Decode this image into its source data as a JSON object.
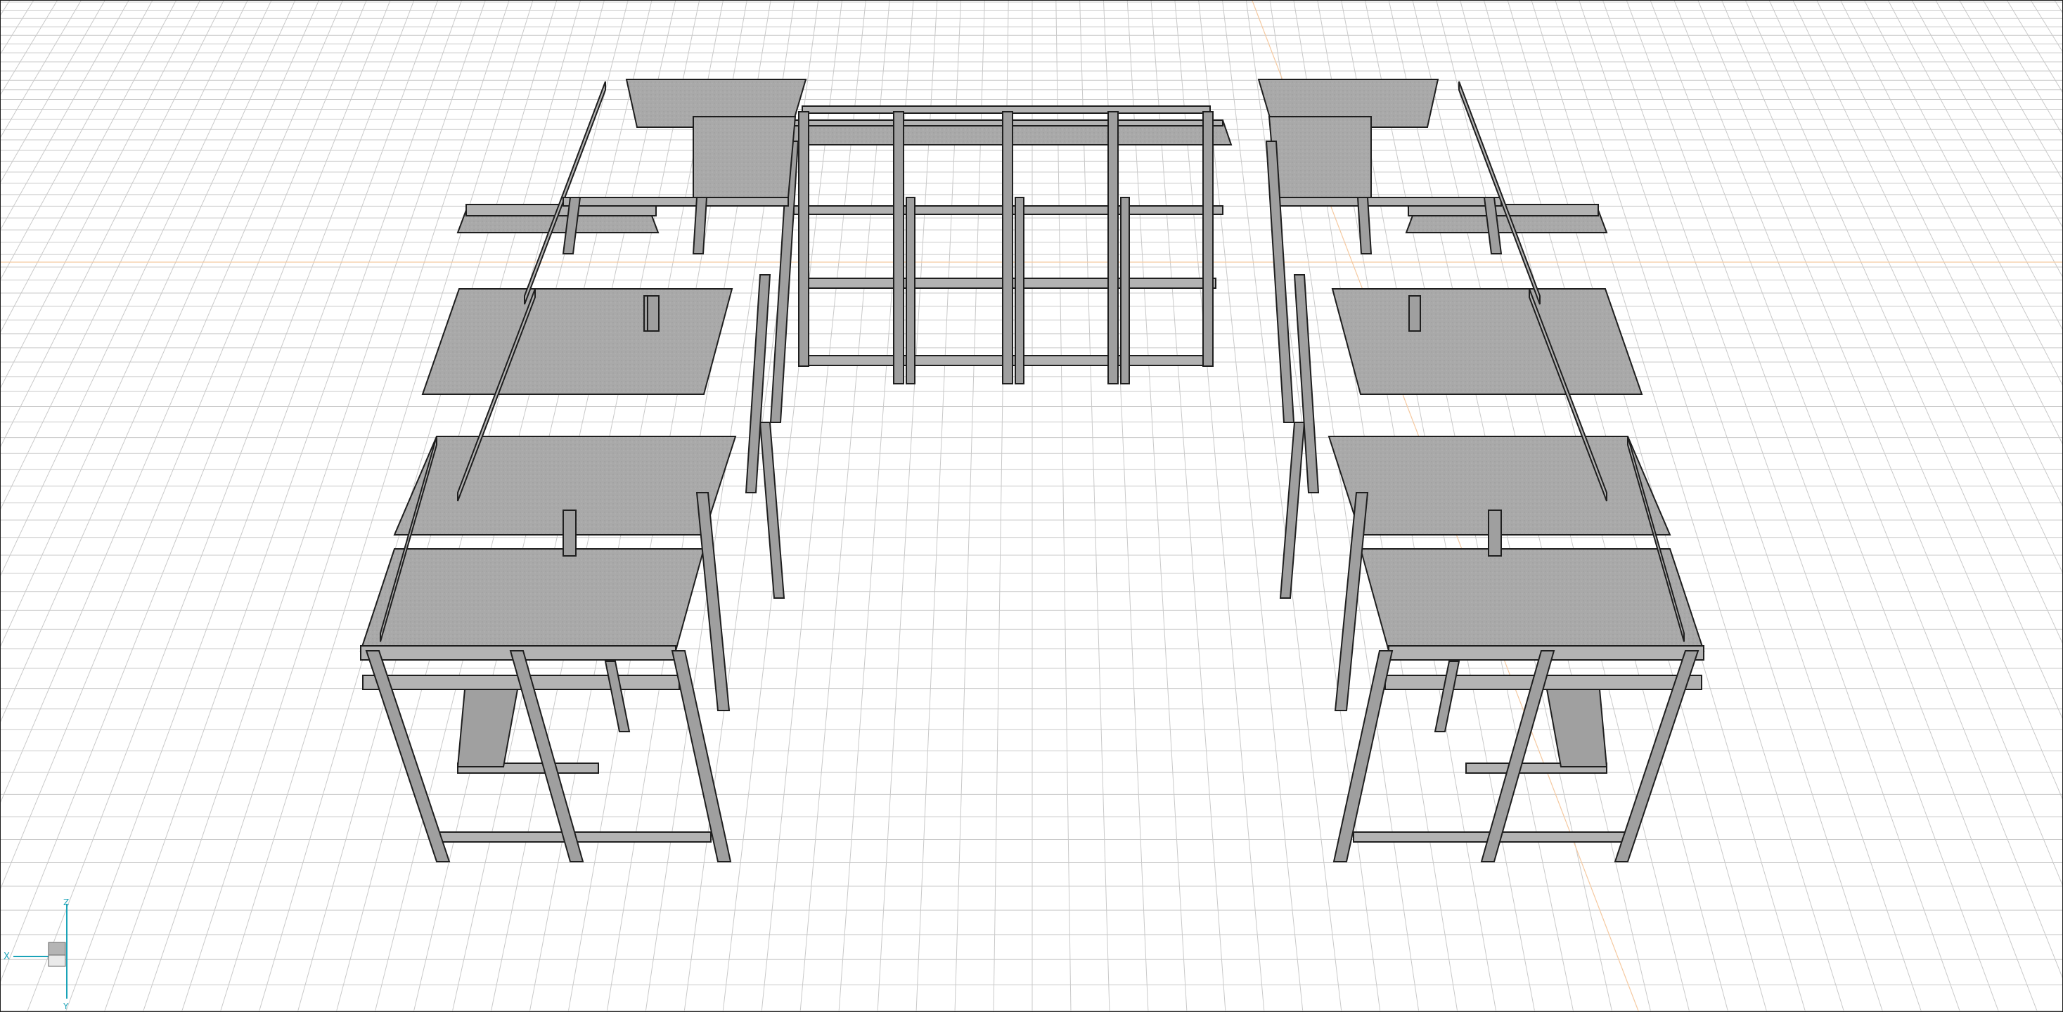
{
  "viewport": {
    "background": "#ffffff",
    "grid_color": "#c9c9c9",
    "accent_line_color": "#f5c9a0",
    "model_color": "#a8a8a8",
    "model_outline_color": "#1e1e1e"
  },
  "axis_triad": {
    "labels": {
      "x": "X",
      "y": "Y",
      "z": "Z"
    },
    "color": "#1aa3b8",
    "cube_color": "#b5b5b5"
  },
  "icons": {
    "axis_triad": "axis-triad-icon"
  }
}
